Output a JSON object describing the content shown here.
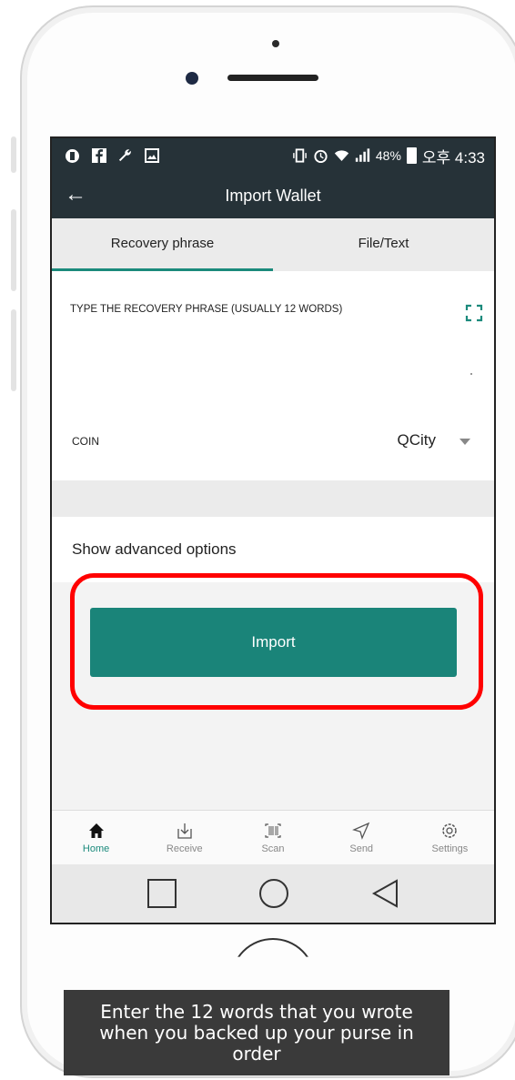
{
  "status_bar": {
    "left_icons": [
      "shield-app-icon",
      "facebook-icon",
      "wrench-icon",
      "image-icon"
    ],
    "right_icons": [
      "vibrate-icon",
      "alarm-icon",
      "wifi-icon",
      "signal-icon",
      "battery-icon"
    ],
    "battery_pct": "48%",
    "time": "오후 4:33"
  },
  "app_bar": {
    "title": "Import Wallet"
  },
  "tabs": [
    {
      "label": "Recovery phrase",
      "active": true
    },
    {
      "label": "File/Text",
      "active": false
    }
  ],
  "phrase": {
    "label": "TYPE THE RECOVERY PHRASE (USUALLY 12 WORDS)",
    "value": ""
  },
  "coin": {
    "label": "COIN",
    "value": "QCity"
  },
  "advanced": {
    "label": "Show advanced options"
  },
  "import_button": {
    "label": "Import"
  },
  "bottom_nav": [
    {
      "label": "Home",
      "icon": "home-icon",
      "active": true
    },
    {
      "label": "Receive",
      "icon": "receive-icon",
      "active": false
    },
    {
      "label": "Scan",
      "icon": "barcode-icon",
      "active": false
    },
    {
      "label": "Send",
      "icon": "send-icon",
      "active": false
    },
    {
      "label": "Settings",
      "icon": "gear-icon",
      "active": false
    }
  ],
  "caption": "Enter the 12 words that you wrote when you backed up your purse in order",
  "colors": {
    "accent": "#1b8a7c",
    "appbar": "#263238",
    "highlight": "#ff0000",
    "button": "#1a8479"
  }
}
